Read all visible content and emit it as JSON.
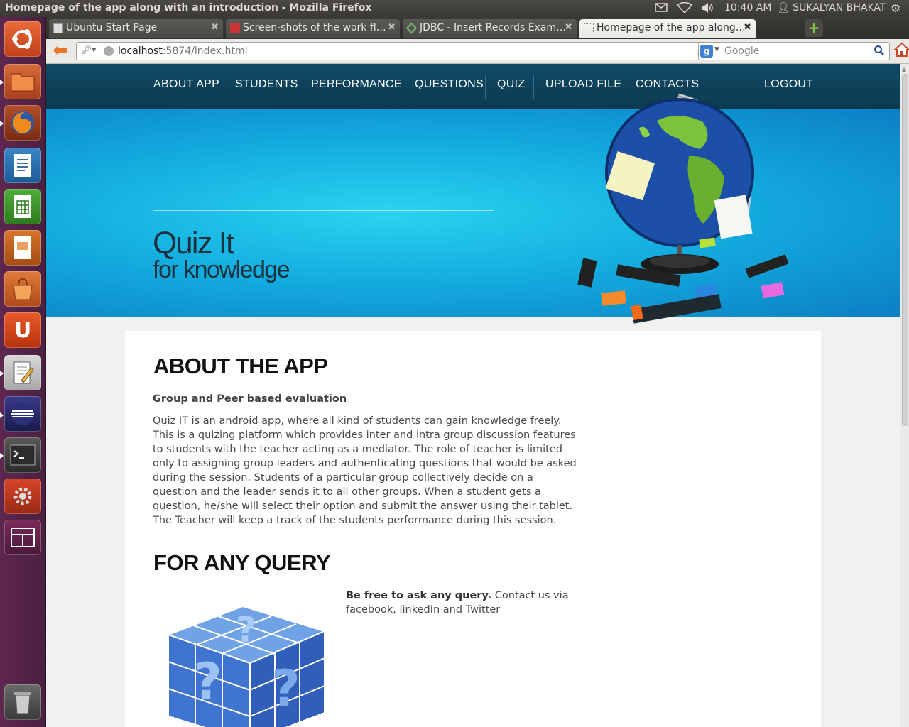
{
  "window": {
    "title": "Homepage of the app along with an introduction - Mozilla Firefox"
  },
  "panel": {
    "clock": "10:40 AM",
    "user": "SUKALYAN BHAKAT"
  },
  "tabs": [
    {
      "label": "Ubuntu Start Page",
      "active": false
    },
    {
      "label": "Screen-shots of the work fl…",
      "active": false
    },
    {
      "label": "JDBC - Insert Records Exam…",
      "active": false
    },
    {
      "label": "Homepage of the app along…",
      "active": true
    }
  ],
  "navbar": {
    "url_host": "localhost",
    "url_rest": ":5874/index.html",
    "search_placeholder": "Google"
  },
  "site": {
    "nav": [
      "ABOUT APP",
      "STUDENTS",
      "PERFORMANCE",
      "QUESTIONS",
      "QUIZ",
      "UPLOAD FILE",
      "CONTACTS"
    ],
    "logout": "LOGOUT",
    "hero_title": "Quiz It",
    "hero_subtitle": "for knowledge"
  },
  "about": {
    "heading": "ABOUT THE APP",
    "subheading": "Group and Peer based evaluation",
    "body": "Quiz IT is an android app, where all kind of students can gain knowledge freely. This is a quizing platform which provides inter and intra group discussion features to students with the teacher acting as a mediator. The role of teacher is limited only to assigning group leaders and authenticating questions that would be asked during the session. Students of a particular group collectively decide on a question and the leader sends it to all other groups. When a student gets a question, he/she will select their option and submit the answer using their tablet. The Teacher will keep a track of the students performance during this session."
  },
  "query": {
    "heading": "FOR ANY QUERY",
    "bold": "Be free to ask any query.",
    "text": " Contact us via facebook, linkedIn and Twitter"
  },
  "colors": {
    "nav_bg": "#0b3a50",
    "hero": "#14aee0",
    "launcher": "#5e2750",
    "accent_orange": "#e9762a"
  }
}
